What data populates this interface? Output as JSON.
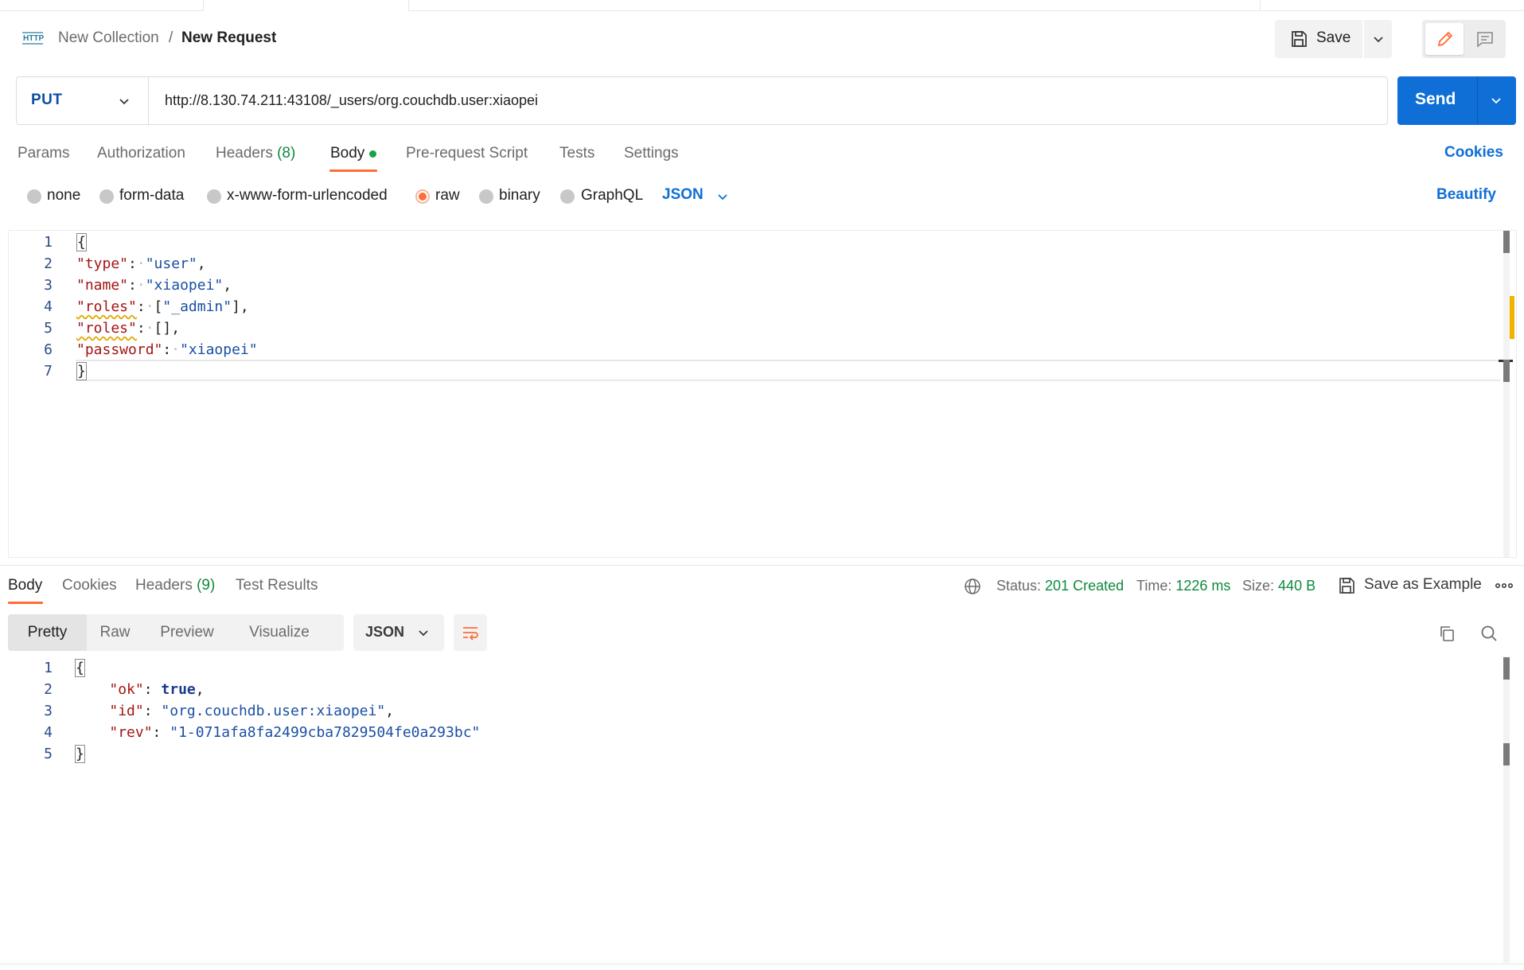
{
  "breadcrumb": {
    "badge": "HTTP",
    "collection": "New Collection",
    "separator": "/",
    "request": "New Request"
  },
  "header": {
    "save_label": "Save"
  },
  "request": {
    "method": "PUT",
    "url": "http://8.130.74.211:43108/_users/org.couchdb.user:xiaopei",
    "send_label": "Send",
    "tabs": {
      "params": "Params",
      "authorization": "Authorization",
      "headers": "Headers",
      "headers_count": "(8)",
      "body": "Body",
      "prerequest": "Pre-request Script",
      "tests": "Tests",
      "settings": "Settings"
    },
    "cookies_link": "Cookies",
    "body_types": {
      "none": "none",
      "form_data": "form-data",
      "urlencoded": "x-www-form-urlencoded",
      "raw": "raw",
      "binary": "binary",
      "graphql": "GraphQL"
    },
    "selected_body_type": "raw",
    "format": "JSON",
    "beautify": "Beautify",
    "line_numbers": [
      "1",
      "2",
      "3",
      "4",
      "5",
      "6",
      "7"
    ],
    "code": {
      "open": "{",
      "l2_key": "\"type\"",
      "l2_val": "\"user\"",
      "l3_key": "\"name\"",
      "l3_val": "\"xiaopei\"",
      "l4_key": "\"roles\"",
      "l4_val": "\"_admin\"",
      "l5_key": "\"roles\"",
      "l6_key": "\"password\"",
      "l6_val": "\"xiaopei\"",
      "close": "}"
    }
  },
  "response": {
    "tabs": {
      "body": "Body",
      "cookies": "Cookies",
      "headers": "Headers",
      "headers_count": "(9)",
      "test_results": "Test Results"
    },
    "status_label": "Status:",
    "status_value": "201 Created",
    "time_label": "Time:",
    "time_value": "1226 ms",
    "size_label": "Size:",
    "size_value": "440 B",
    "save_example": "Save as Example",
    "views": {
      "pretty": "Pretty",
      "raw": "Raw",
      "preview": "Preview",
      "visualize": "Visualize"
    },
    "format": "JSON",
    "line_numbers": [
      "1",
      "2",
      "3",
      "4",
      "5"
    ],
    "code": {
      "open": "{",
      "ok_key": "\"ok\"",
      "ok_val": "true",
      "id_key": "\"id\"",
      "id_val": "\"org.couchdb.user:xiaopei\"",
      "rev_key": "\"rev\"",
      "rev_val": "\"1-071afa8fa2499cba7829504fe0a293bc\"",
      "close": "}"
    }
  },
  "colors": {
    "accent_orange": "#ff6c37",
    "send_blue": "#0f6fd6",
    "status_green": "#0e8a3e",
    "json_key": "#a31515",
    "json_string": "#1a4fa3"
  },
  "icons": {
    "http_badge": "http-icon",
    "save": "floppy-disk-icon",
    "edit": "pencil-icon",
    "comments": "comment-icon",
    "globe": "globe-icon",
    "copy": "copy-icon",
    "search": "search-icon",
    "wrap": "wrap-lines-icon",
    "more": "more-horizontal-icon"
  }
}
